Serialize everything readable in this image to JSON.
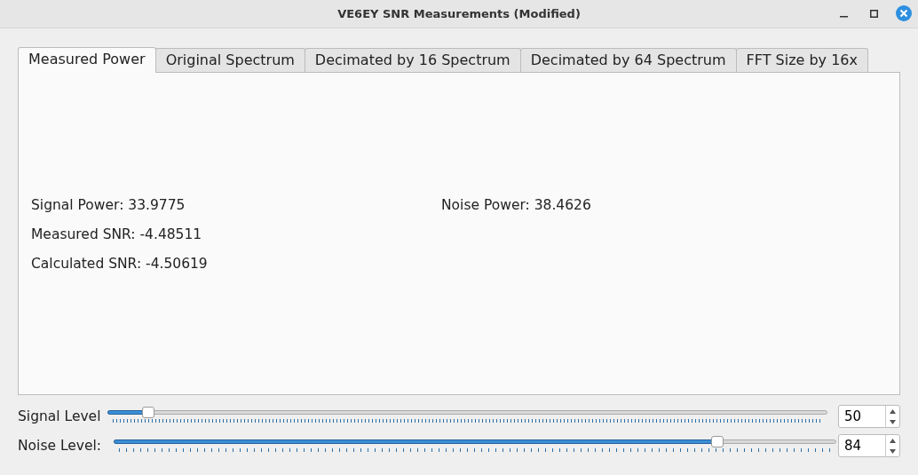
{
  "window": {
    "title": "VE6EY SNR Measurements (Modified)"
  },
  "tabs": [
    {
      "label": "Measured Power",
      "selected": true
    },
    {
      "label": "Original Spectrum",
      "selected": false
    },
    {
      "label": "Decimated by 16 Spectrum",
      "selected": false
    },
    {
      "label": "Decimated by 64 Spectrum",
      "selected": false
    },
    {
      "label": "FFT Size by 16x",
      "selected": false
    }
  ],
  "readings": {
    "signal_power": "Signal Power: 33.9775",
    "noise_power": "Noise Power: 38.4626",
    "measured_snr": "Measured SNR: -4.48511",
    "calculated_snr": "Calculated SNR: -4.50619"
  },
  "sliders": [
    {
      "label": "Signal Level",
      "level": 0.056,
      "value": "50"
    },
    {
      "label": "Noise Level:",
      "level": 0.835,
      "value": "84"
    }
  ]
}
